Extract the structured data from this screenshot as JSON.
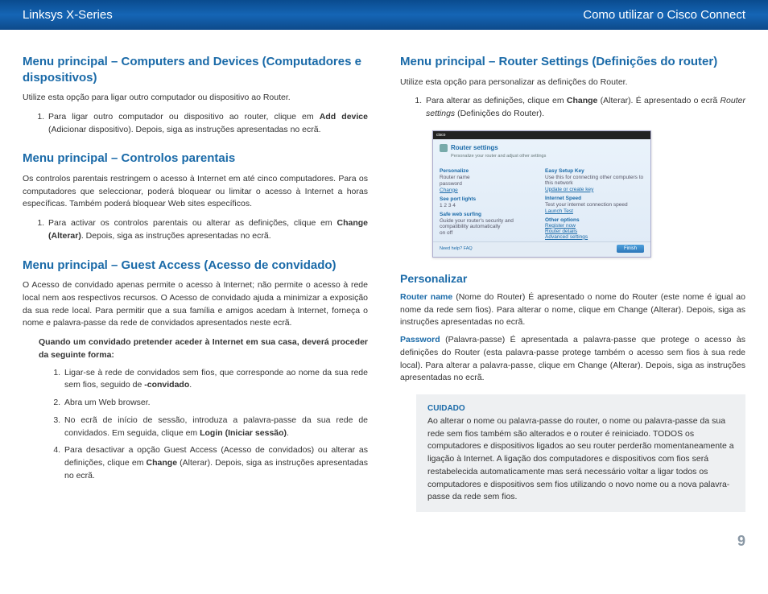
{
  "header": {
    "left": "Linksys X-Series",
    "right": "Como utilizar o Cisco Connect"
  },
  "left": {
    "s1": {
      "title": "Menu principal – Computers and Devices (Computadores e dispositivos)",
      "intro": "Utilize esta opção para ligar outro computador ou dispositivo ao Router.",
      "li1a": "Para ligar outro computador ou dispositivo ao router, clique em ",
      "li1b": "Add device",
      "li1c": " (Adicionar dispositivo). Depois, siga as instruções apresentadas no ecrã."
    },
    "s2": {
      "title": "Menu principal – Controlos parentais",
      "intro": "Os controlos parentais restringem o acesso à Internet em até cinco computadores. Para os computadores que seleccionar, poderá bloquear ou limitar o acesso à Internet a horas específicas. Também poderá bloquear Web sites específicos.",
      "li1a": "Para activar os controlos parentais ou alterar as definições, clique em ",
      "li1b": "Change (Alterar)",
      "li1c": ". Depois, siga as instruções apresentadas no ecrã."
    },
    "s3": {
      "title": "Menu principal – Guest Access (Acesso de convidado)",
      "intro": "O Acesso de convidado apenas permite o acesso à Internet; não permite o acesso à rede local nem aos respectivos recursos. O Acesso de convidado ajuda a minimizar a exposição da sua rede local. Para permitir que a sua família e amigos acedam à Internet, forneça o nome e palavra-passe da rede de convidados apresentados neste ecrã.",
      "sub": "Quando um convidado pretender aceder à Internet em sua casa, deverá proceder da seguinte forma:",
      "li1a": "Ligar-se à rede de convidados sem fios, que corresponde ao nome da sua rede sem fios, seguido de ",
      "li1b": "-convidado",
      "li1c": ".",
      "li2": "Abra um Web browser.",
      "li3a": "No ecrã de início de sessão, introduza a palavra-passe da sua rede de convidados. Em seguida, clique em ",
      "li3b": "Login (Iniciar sessão)",
      "li3c": ".",
      "li4a": "Para desactivar a opção Guest Access (Acesso de convidados) ou alterar as definições, clique em ",
      "li4b": "Change",
      "li4c": " (Alterar). Depois, siga as instruções apresentadas no ecrã."
    }
  },
  "right": {
    "s1": {
      "title": "Menu principal – Router Settings (Definições do router)",
      "intro": "Utilize esta opção para personalizar as definições do Router.",
      "li1a": "Para alterar as definições, clique em ",
      "li1b": "Change",
      "li1c": " (Alterar). É apresentado o ecrã ",
      "li1d": "Router settings",
      "li1e": " (Definições do Router)."
    },
    "s2": {
      "title": "Personalizar",
      "p1a": "Router name",
      "p1b": " (Nome do Router)  É apresentado o nome do Router (este nome é igual ao nome da rede sem fios). Para alterar o nome, clique em Change (Alterar). Depois, siga as instruções apresentadas no ecrã.",
      "p2a": "Password",
      "p2b": " (Palavra-passe)  É apresentada a palavra-passe que protege o acesso às definições do Router (esta palavra-passe protege também o acesso sem fios à sua rede local). Para alterar a palavra-passe, clique em Change (Alterar). Depois, siga as instruções apresentadas no ecrã."
    },
    "caution": {
      "title": "Cuidado",
      "body": "Ao alterar o nome ou palavra-passe do router, o nome ou palavra-passe da sua rede sem fios também são alterados e o router é reiniciado. TODOS os computadores e dispositivos ligados ao seu router perderão momentaneamente a ligação à Internet. A ligação dos computadores e dispositivos com fios será restabelecida automaticamente mas será necessário voltar a ligar todos os computadores e dispositivos sem fios utilizando o novo nome ou a nova palavra-passe da rede sem fios."
    }
  },
  "shot": {
    "brand": "cisco",
    "title": "Router settings",
    "subtitle": "Personalize your router and adjust other settings",
    "left": {
      "l1": "Personalize",
      "v1a": "Router name",
      "v1b": "password",
      "link1": "Change",
      "l2": "See port lights",
      "v2a": "1  2  3  4",
      "l3": "Safe web surfing",
      "v3": "Guide your router's security and compatibility automatically",
      "radio": "on    off"
    },
    "right": {
      "l1": "Easy Setup Key",
      "v1": "Use this for connecting other computers to this network",
      "link1": "Update or create key",
      "l2": "Internet Speed",
      "v2": "Test your internet connection speed",
      "link2": "Launch Test",
      "l3": "Other options",
      "link3a": "Register now",
      "link3b": "Router details",
      "link3c": "Advanced settings"
    },
    "foot_left": "Need help?    FAQ",
    "foot_btn": "Finish"
  },
  "page": "9"
}
